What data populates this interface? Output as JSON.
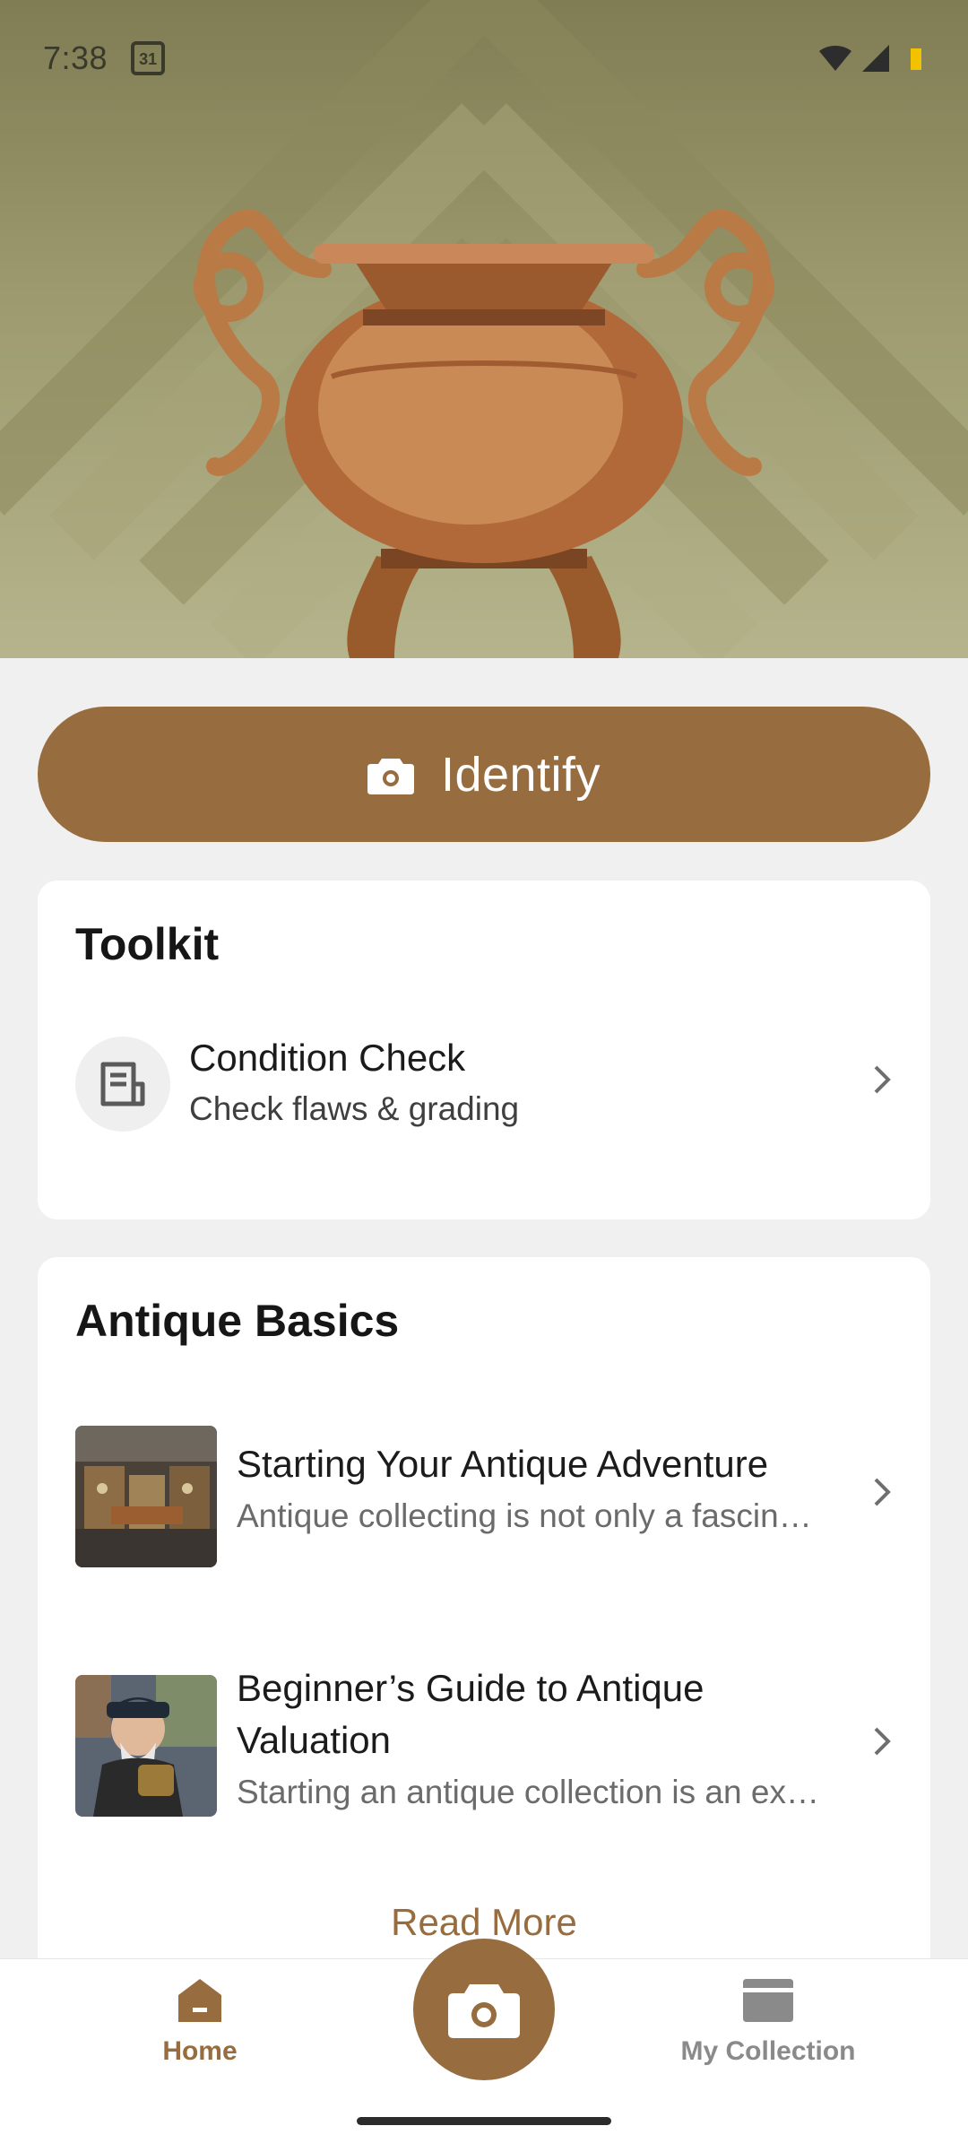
{
  "status_bar": {
    "time": "7:38",
    "calendar_day": "31",
    "icons": [
      "wifi-icon",
      "signal-icon",
      "battery-icon"
    ]
  },
  "hero": {
    "illustration": "antique-urn-illustration",
    "colors": {
      "bg_top": "#807c54",
      "bg_bottom": "#b6b48c",
      "urn": "#b8743e"
    }
  },
  "identify": {
    "label": "Identify",
    "icon": "camera-icon"
  },
  "toolkit": {
    "title": "Toolkit",
    "items": [
      {
        "title": "Condition Check",
        "subtitle": "Check flaws & grading",
        "icon": "document-icon"
      }
    ]
  },
  "basics": {
    "title": "Antique Basics",
    "articles": [
      {
        "title": "Starting Your Antique Adventure",
        "excerpt": "Antique collecting is not only a fascinating hobby"
      },
      {
        "title": "Beginner’s Guide to Antique Valuation",
        "excerpt": "Starting an antique collection is an exciting journey"
      }
    ],
    "read_more": "Read More"
  },
  "bottom_nav": {
    "items": [
      {
        "label": "Home",
        "icon": "home-icon",
        "active": true
      },
      {
        "label": "My Collection",
        "icon": "folder-icon",
        "active": false
      }
    ],
    "fab_icon": "camera-icon"
  },
  "colors": {
    "accent": "#976c3e",
    "background": "#f0f0f0",
    "card": "#ffffff"
  }
}
